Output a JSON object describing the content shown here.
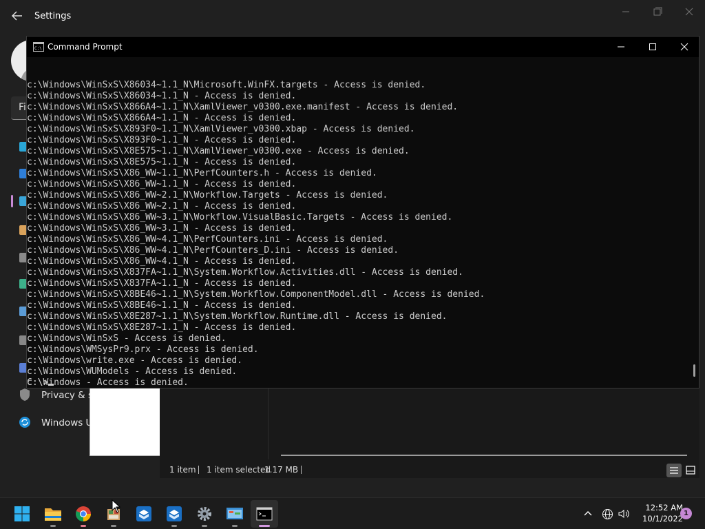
{
  "settings": {
    "title": "Settings",
    "search_fragment": "Fi",
    "nav": [
      {
        "label": "Privacy & s",
        "icon": "shield-icon"
      },
      {
        "label": "Windows U",
        "icon": "windows-update-icon"
      }
    ]
  },
  "explorer": {
    "status": {
      "item_count": "1 item",
      "selection": "1 item selected",
      "size": "1.17 MB"
    }
  },
  "cmd": {
    "title": "Command Prompt",
    "lines": [
      "c:\\Windows\\WinSxS\\X86034~1.1_N\\Microsoft.WinFX.targets - Access is denied.",
      "c:\\Windows\\WinSxS\\X86034~1.1_N - Access is denied.",
      "c:\\Windows\\WinSxS\\X866A4~1.1_N\\XamlViewer_v0300.exe.manifest - Access is denied.",
      "c:\\Windows\\WinSxS\\X866A4~1.1_N - Access is denied.",
      "c:\\Windows\\WinSxS\\X893F0~1.1_N\\XamlViewer_v0300.xbap - Access is denied.",
      "c:\\Windows\\WinSxS\\X893F0~1.1_N - Access is denied.",
      "c:\\Windows\\WinSxS\\X8E575~1.1_N\\XamlViewer_v0300.exe - Access is denied.",
      "c:\\Windows\\WinSxS\\X8E575~1.1_N - Access is denied.",
      "c:\\Windows\\WinSxS\\X86_WW~1.1_N\\PerfCounters.h - Access is denied.",
      "c:\\Windows\\WinSxS\\X86_WW~1.1_N - Access is denied.",
      "c:\\Windows\\WinSxS\\X86_WW~2.1_N\\Workflow.Targets - Access is denied.",
      "c:\\Windows\\WinSxS\\X86_WW~2.1_N - Access is denied.",
      "c:\\Windows\\WinSxS\\X86_WW~3.1_N\\Workflow.VisualBasic.Targets - Access is denied.",
      "c:\\Windows\\WinSxS\\X86_WW~3.1_N - Access is denied.",
      "c:\\Windows\\WinSxS\\X86_WW~4.1_N\\PerfCounters.ini - Access is denied.",
      "c:\\Windows\\WinSxS\\X86_WW~4.1_N\\PerfCounters_D.ini - Access is denied.",
      "c:\\Windows\\WinSxS\\X86_WW~4.1_N - Access is denied.",
      "c:\\Windows\\WinSxS\\X837FA~1.1_N\\System.Workflow.Activities.dll - Access is denied.",
      "c:\\Windows\\WinSxS\\X837FA~1.1_N - Access is denied.",
      "c:\\Windows\\WinSxS\\X8BE46~1.1_N\\System.Workflow.ComponentModel.dll - Access is denied.",
      "c:\\Windows\\WinSxS\\X8BE46~1.1_N - Access is denied.",
      "c:\\Windows\\WinSxS\\X8E287~1.1_N\\System.Workflow.Runtime.dll - Access is denied.",
      "c:\\Windows\\WinSxS\\X8E287~1.1_N - Access is denied.",
      "c:\\Windows\\WinSxS - Access is denied.",
      "c:\\Windows\\WMSysPr9.prx - Access is denied.",
      "c:\\Windows\\write.exe - Access is denied.",
      "c:\\Windows\\WUModels - Access is denied.",
      "c:\\Windows - Access is denied."
    ],
    "prompt": "C:\\>"
  },
  "taskbar": {
    "apps": [
      {
        "name": "start",
        "icon": "windows-start-icon"
      },
      {
        "name": "file-explorer",
        "icon": "folder-icon"
      },
      {
        "name": "chrome",
        "icon": "chrome-icon"
      },
      {
        "name": "app-4",
        "icon": "paint-app-icon"
      },
      {
        "name": "app-5",
        "icon": "sandbox-box-icon"
      },
      {
        "name": "app-6",
        "icon": "sandbox-box-icon"
      },
      {
        "name": "settings",
        "icon": "gear-icon"
      },
      {
        "name": "control-panel",
        "icon": "control-panel-icon"
      },
      {
        "name": "command-prompt",
        "icon": "terminal-icon"
      }
    ],
    "time": "12:52 AM",
    "date": "10/1/2022",
    "notification_count": "1"
  },
  "colors": {
    "console_bg": "#0c0c0c",
    "console_text": "#cccccc",
    "accent": "#c98ad6"
  }
}
